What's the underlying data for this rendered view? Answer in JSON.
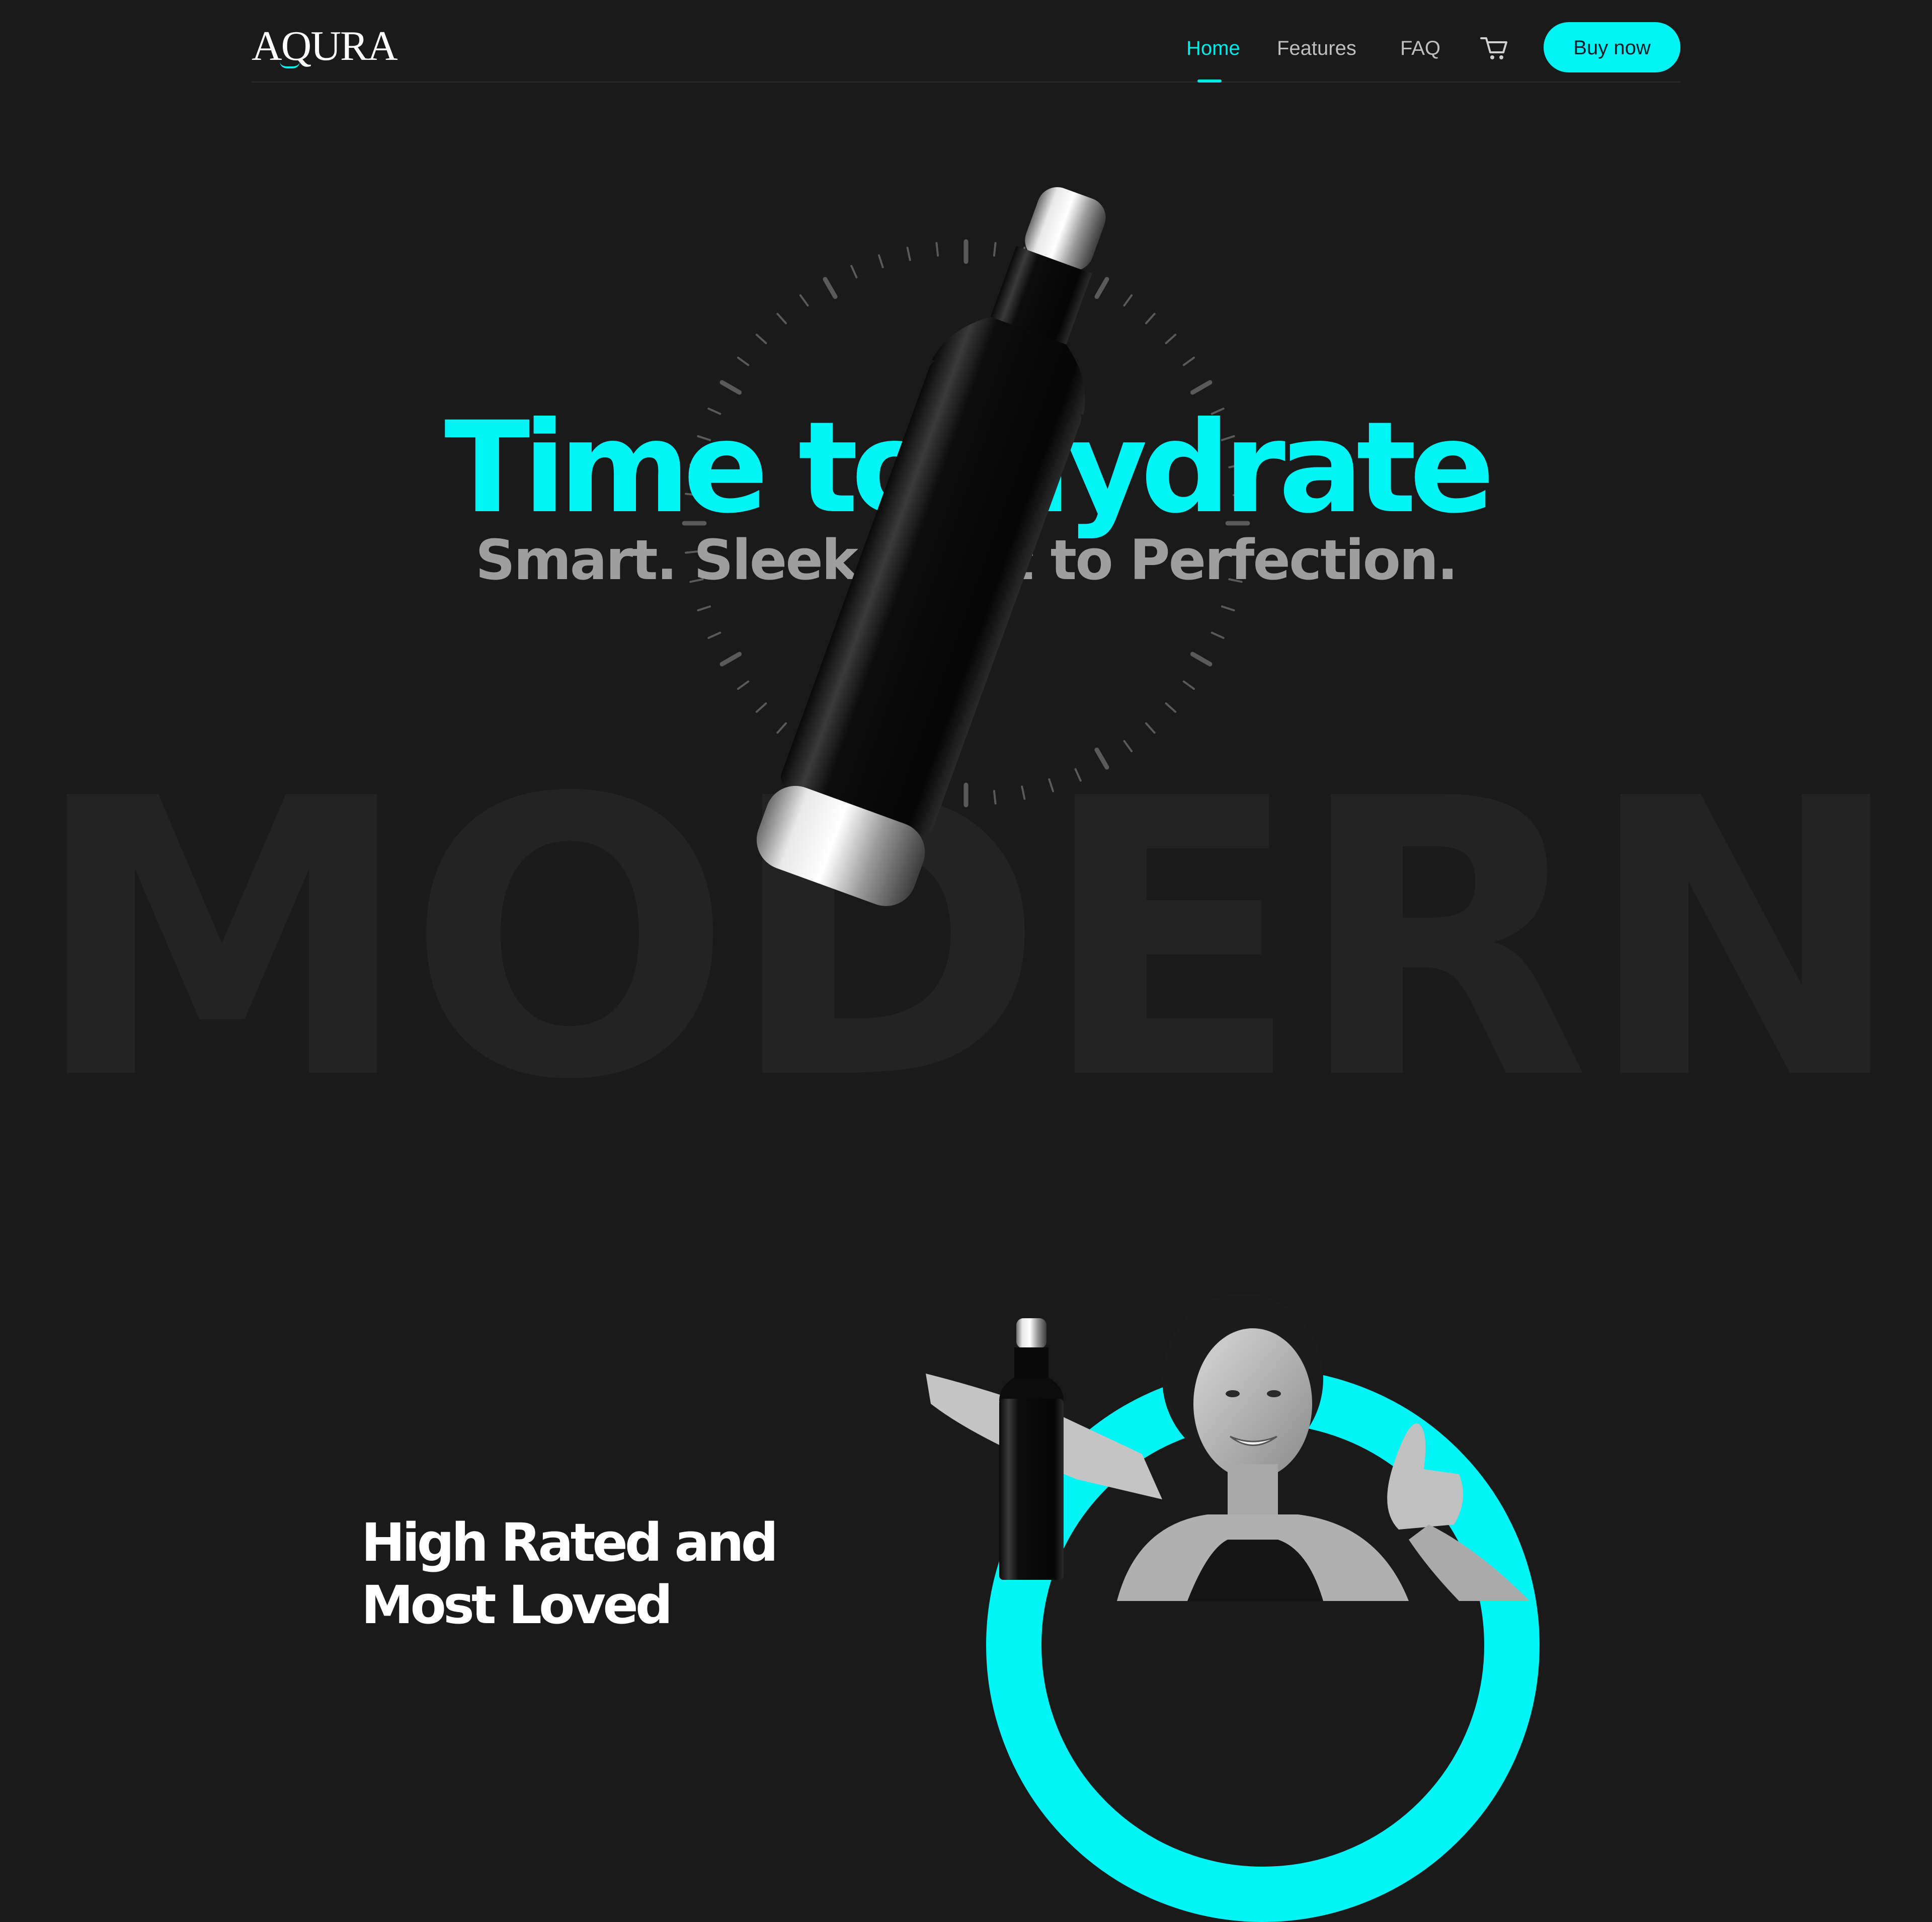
{
  "brand": {
    "logo_text": "AQURA",
    "accent_color": "#00F4F4",
    "background_color": "#1A1A1A"
  },
  "nav": {
    "links": [
      {
        "label": "Home",
        "active": true
      },
      {
        "label": "Features",
        "active": false
      },
      {
        "label": "FAQ",
        "active": false
      }
    ],
    "cart_icon": "cart-icon",
    "buy_label": "Buy now"
  },
  "hero": {
    "title": "Time to Hydrate",
    "subtitle": "Smart. Sleek. Built to Perfection.",
    "background_word": "MODERN"
  },
  "section2": {
    "title_line1": "High Rated and",
    "title_line2": "Most Loved"
  }
}
